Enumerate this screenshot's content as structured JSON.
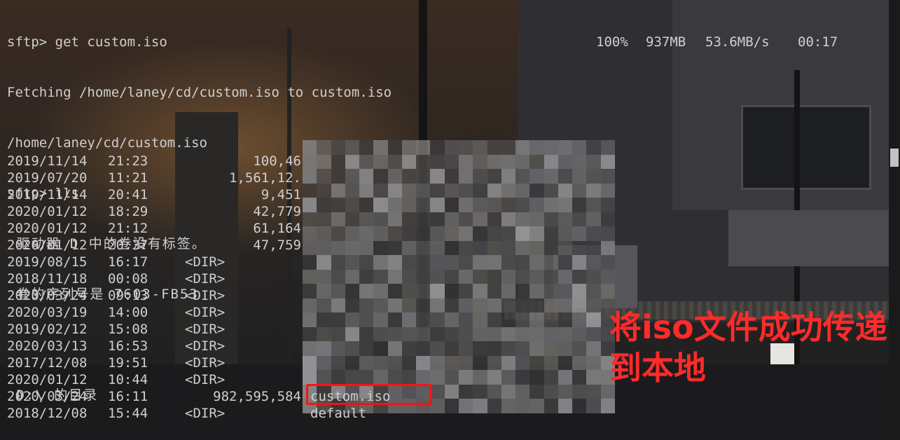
{
  "terminal": {
    "lines": [
      "sftp> get custom.iso",
      "Fetching /home/laney/cd/custom.iso to custom.iso",
      "/home/laney/cd/custom.iso",
      "sftp> lls",
      " 驱动器 D 中的卷没有标签。",
      " 卷的序列号是 7603-FB53",
      "",
      " D:\\ 的目录"
    ],
    "transfer": {
      "percent": "100%",
      "size": "937MB",
      "speed": "53.6MB/s",
      "eta": "00:17"
    },
    "listing": [
      {
        "date": "2019/11/14",
        "time": "21:23",
        "size": "100,46",
        "dir": "",
        "name": ""
      },
      {
        "date": "2019/07/20",
        "time": "11:21",
        "size": "1,561,12.",
        "dir": "",
        "name": ""
      },
      {
        "date": "2019/11/14",
        "time": "20:41",
        "size": "9,451",
        "dir": "",
        "name": ""
      },
      {
        "date": "2020/01/12",
        "time": "18:29",
        "size": "42,779",
        "dir": "",
        "name": ""
      },
      {
        "date": "2020/01/12",
        "time": "21:12",
        "size": "61,164",
        "dir": "",
        "name": ""
      },
      {
        "date": "2020/01/12",
        "time": "20:37",
        "size": "47,759",
        "dir": "",
        "name": ""
      },
      {
        "date": "2019/08/15",
        "time": "16:17",
        "size": "",
        "dir": "<DIR>",
        "name": ""
      },
      {
        "date": "2018/11/18",
        "time": "00:08",
        "size": "",
        "dir": "<DIR>",
        "name": ""
      },
      {
        "date": "2020/03/24",
        "time": "09:13",
        "size": "",
        "dir": "<DIR>",
        "name": ""
      },
      {
        "date": "2020/03/19",
        "time": "14:00",
        "size": "",
        "dir": "<DIR>",
        "name": ""
      },
      {
        "date": "2019/02/12",
        "time": "15:08",
        "size": "",
        "dir": "<DIR>",
        "name": ""
      },
      {
        "date": "2020/03/13",
        "time": "16:53",
        "size": "",
        "dir": "<DIR>",
        "name": ""
      },
      {
        "date": "2017/12/08",
        "time": "19:51",
        "size": "",
        "dir": "<DIR>",
        "name": ""
      },
      {
        "date": "2020/01/12",
        "time": "10:44",
        "size": "",
        "dir": "<DIR>",
        "name": ""
      },
      {
        "date": "2020/03/24",
        "time": "16:11",
        "size": "982,595,584",
        "dir": "",
        "name": "custom.iso"
      },
      {
        "date": "2018/12/08",
        "time": "15:44",
        "size": "",
        "dir": "<DIR>",
        "name": "default"
      }
    ]
  },
  "annotation": {
    "text": "将iso文件成功传递到本地",
    "color": "#ff2a2a"
  },
  "highlight_color": "#ff1010"
}
